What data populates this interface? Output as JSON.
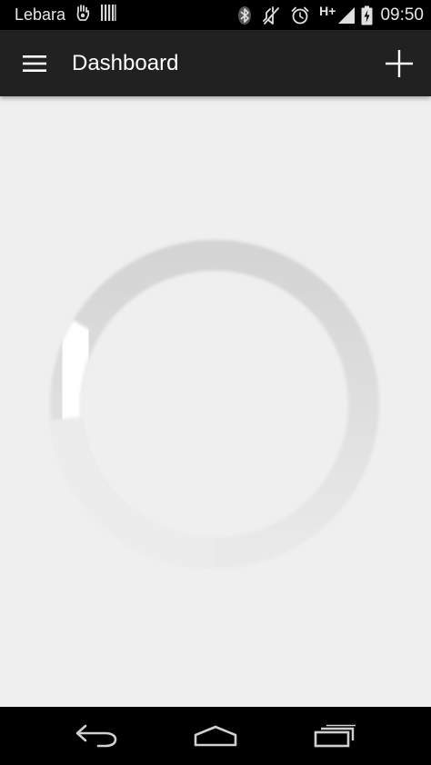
{
  "status_bar": {
    "carrier": "Lebara",
    "network_type": "H+",
    "time": "09:50",
    "icons": [
      "hand-notification-icon",
      "barcode-notification-icon",
      "bluetooth-icon",
      "mute-icon",
      "alarm-icon",
      "signal-icon",
      "battery-charging-icon"
    ]
  },
  "app_bar": {
    "title": "Dashboard",
    "background": "#212121",
    "icons": [
      "menu-icon",
      "add-icon"
    ]
  },
  "content": {
    "background": "#efefef",
    "loading_spinner": {
      "ring_color": "#d6d6d6",
      "highlight_color": "#ffffff"
    }
  },
  "nav_bar": {
    "icons": [
      "back-icon",
      "home-icon",
      "recent-apps-icon"
    ]
  }
}
